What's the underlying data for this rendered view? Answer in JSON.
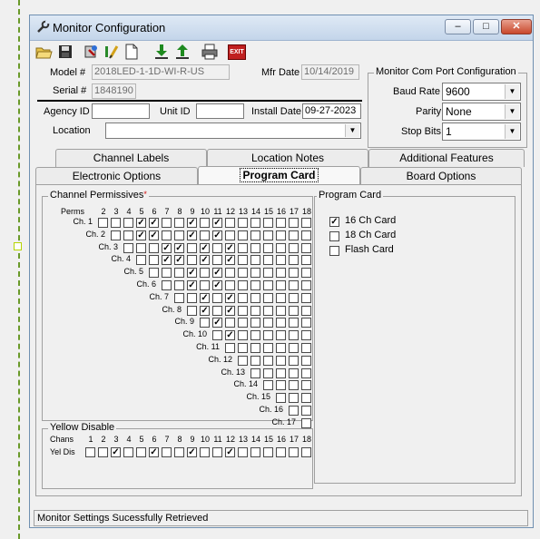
{
  "window": {
    "title": "Monitor Configuration",
    "minimize": "–",
    "maximize": "□",
    "close": "✕"
  },
  "toolbar": {
    "icons": [
      "open-folder-icon",
      "save-icon",
      "read-monitor-icon",
      "edit-icon",
      "new-document-icon",
      "download-icon",
      "upload-icon",
      "print-icon",
      "exit-icon"
    ],
    "exit_label": "EXIT"
  },
  "form": {
    "model_label": "Model #",
    "model_value": "2018LED-1-1D-WI-R-US",
    "serial_label": "Serial #",
    "serial_value": "1848190",
    "mfr_date_label": "Mfr Date",
    "mfr_date_value": "10/14/2019",
    "agency_label": "Agency ID",
    "agency_value": "",
    "unit_label": "Unit ID",
    "unit_value": "",
    "install_label": "Install Date",
    "install_value": "09-27-2023",
    "location_label": "Location",
    "location_value": ""
  },
  "com_port": {
    "title": "Monitor Com Port Configuration",
    "baud_label": "Baud Rate",
    "baud_value": "9600",
    "parity_label": "Parity",
    "parity_value": "None",
    "stop_label": "Stop Bits",
    "stop_value": "1"
  },
  "tabs": {
    "row1": [
      "Channel Labels",
      "Location Notes",
      "Additional Features"
    ],
    "row2": [
      "Electronic Options",
      "Program Card",
      "Board Options"
    ],
    "active": "Program Card"
  },
  "permissives": {
    "title": "Channel Permissives",
    "required_mark": "*",
    "perms_label": "Perms",
    "columns": [
      "2",
      "3",
      "4",
      "5",
      "6",
      "7",
      "8",
      "9",
      "10",
      "11",
      "12",
      "13",
      "14",
      "15",
      "16",
      "17",
      "18"
    ],
    "rows": [
      {
        "label": "Ch. 1",
        "checked": [
          5,
          6,
          9,
          11
        ]
      },
      {
        "label": "Ch. 2",
        "checked": [
          5,
          6,
          9,
          11
        ]
      },
      {
        "label": "Ch. 3",
        "checked": [
          7,
          8,
          10,
          12
        ]
      },
      {
        "label": "Ch. 4",
        "checked": [
          7,
          8,
          10,
          12
        ]
      },
      {
        "label": "Ch. 5",
        "checked": [
          9,
          11
        ]
      },
      {
        "label": "Ch. 6",
        "checked": [
          9,
          11
        ]
      },
      {
        "label": "Ch. 7",
        "checked": [
          10,
          12
        ]
      },
      {
        "label": "Ch. 8",
        "checked": [
          10,
          12
        ]
      },
      {
        "label": "Ch. 9",
        "checked": [
          11
        ]
      },
      {
        "label": "Ch. 10",
        "checked": [
          12
        ]
      },
      {
        "label": "Ch. 11",
        "checked": []
      },
      {
        "label": "Ch. 12",
        "checked": []
      },
      {
        "label": "Ch. 13",
        "checked": []
      },
      {
        "label": "Ch. 14",
        "checked": []
      },
      {
        "label": "Ch. 15",
        "checked": []
      },
      {
        "label": "Ch. 16",
        "checked": []
      },
      {
        "label": "Ch. 17",
        "checked": []
      }
    ]
  },
  "yellow_disable": {
    "title": "Yellow Disable",
    "chans_label": "Chans",
    "row_label": "Yel Dis",
    "columns": [
      "1",
      "2",
      "3",
      "4",
      "5",
      "6",
      "7",
      "8",
      "9",
      "10",
      "11",
      "12",
      "13",
      "14",
      "15",
      "16",
      "17",
      "18"
    ],
    "checked": [
      3,
      6,
      9,
      12
    ]
  },
  "program_card": {
    "title": "Program Card",
    "options": [
      {
        "label": "16 Ch Card",
        "checked": true
      },
      {
        "label": "18 Ch Card",
        "checked": false
      },
      {
        "label": "Flash Card",
        "checked": false
      }
    ]
  },
  "status": {
    "text": "Monitor Settings Sucessfully Retrieved"
  },
  "check_glyph": "✓"
}
